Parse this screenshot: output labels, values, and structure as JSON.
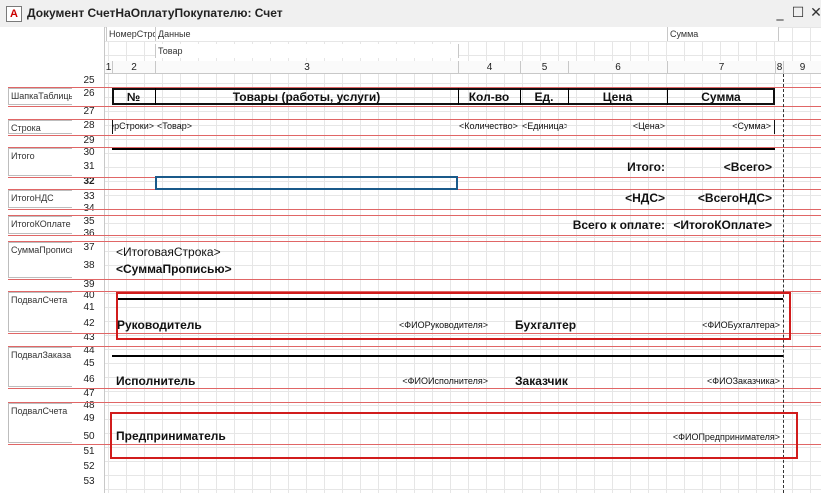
{
  "window": {
    "title": "Документ СчетНаОплатуПокупателю: Счет",
    "icon_name": "app-icon",
    "minimize": "_",
    "maximize": "☐",
    "close": "✕"
  },
  "header_rows": {
    "r1": [
      "НомерСтроки",
      "Данные",
      "Сумма"
    ],
    "r2": [
      "Товар"
    ]
  },
  "column_numbers": [
    "1",
    "2",
    "3",
    "4",
    "5",
    "6",
    "7",
    "8",
    "9"
  ],
  "row_numbers": [
    "25",
    "26",
    "27",
    "28",
    "29",
    "30",
    "31",
    "32",
    "33",
    "34",
    "35",
    "36",
    "37",
    "38",
    "39",
    "40",
    "41",
    "42",
    "43",
    "44",
    "45",
    "46",
    "47",
    "48",
    "49",
    "50",
    "51",
    "52",
    "53"
  ],
  "sections": [
    "ШапкаТаблицы",
    "Строка",
    "Итого",
    "ИтогоНДС",
    "ИтогоКОплате",
    "СуммаПрописью",
    "ПодвалСчета",
    "ПодвалЗаказа",
    "ПодвалСчета"
  ],
  "table_header": {
    "num": "№",
    "goods": "Товары (работы, услуги)",
    "qty": "Кол-во",
    "unit": "Ед.",
    "price": "Цена",
    "sum": "Сумма"
  },
  "table_row": {
    "num": "<НомерСтроки>",
    "goods": "<Товар>",
    "qty": "<Количество>",
    "unit": "<Единица>",
    "price": "<Цена>",
    "sum": "<Сумма>"
  },
  "totals": {
    "total_label": "Итого:",
    "total_value": "<Всего>",
    "vat_label": "<НДС>",
    "vat_value": "<ВсегоНДС>",
    "pay_label": "Всего к оплате:",
    "pay_value": "<ИтогоКОплате>"
  },
  "summary": {
    "line": "<ИтоговаяСтрока>",
    "words": "<СуммаПрописью>"
  },
  "footer_invoice": {
    "director_label": "Руководитель",
    "director_value": "<ФИОРуководителя>",
    "accountant_label": "Бухгалтер",
    "accountant_value": "<ФИОБухгалтера>"
  },
  "footer_order": {
    "executor_label": "Исполнитель",
    "executor_value": "<ФИОИсполнителя>",
    "customer_label": "Заказчик",
    "customer_value": "<ФИОЗаказчика>"
  },
  "footer_entrepreneur": {
    "label": "Предприниматель",
    "value": "<ФИОПредпринимателя>"
  },
  "colors": {
    "red_highlight": "#d11c1c",
    "grid": "#e6e6e6",
    "selection": "#1a5a8a"
  }
}
